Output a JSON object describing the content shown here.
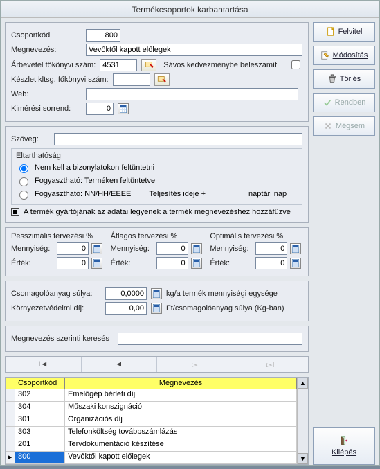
{
  "title": "Termékcsoportok karbantartása",
  "labels": {
    "csoportkod": "Csoportkód",
    "megnevezes": "Megnevezés:",
    "arbevetel": "Árbevétel főkönyvi szám:",
    "savos": "Sávos kedvezménybe beleszámít",
    "keszlet": "Készlet kltsg. főkönyvi szám:",
    "web": "Web:",
    "kimeresi": "Kimérési sorrend:",
    "szoveg": "Szöveg:",
    "eltart": "Eltarthatóság",
    "radio1": "Nem kell a bizonylatokon feltüntetni",
    "radio2": "Fogyasztható: Terméken feltüntetve",
    "radio3": "Fogyasztható: NN/HH/EEEE",
    "teljesites": "Teljesítés ideje +",
    "naptari": "naptári nap",
    "gyarto": "A termék gyártójának az adatai legyenek a termék megnevezéshez hozzáfűzve",
    "pessz": "Pesszimális tervezési %",
    "atlag": "Átlagos tervezési %",
    "opt": "Optimális tervezési %",
    "menny": "Mennyiség:",
    "ertek": "Érték:",
    "csomag": "Csomagolóanyag súlya:",
    "csomag_unit": "kg/a termék mennyiségi egysége",
    "korny": "Környezetvédelmi díj:",
    "korny_unit": "Ft/csomagolóanyag súlya (Kg-ban)",
    "kereses": "Megnevezés szerinti keresés"
  },
  "values": {
    "csoportkod": "800",
    "megnevezes": "Vevőktől kapott előlegek",
    "arbevetel": "4531",
    "keszlet": "",
    "web": "",
    "kimeresi": "0",
    "szoveg": "",
    "pessz_m": "0",
    "pessz_e": "0",
    "atlag_m": "0",
    "atlag_e": "0",
    "opt_m": "0",
    "opt_e": "0",
    "csomag": "0,0000",
    "korny": "0,00",
    "kereses": ""
  },
  "buttons": {
    "felvitel": "Felvitel",
    "modositas": "Módosítás",
    "torles": "Törlés",
    "rendben": "Rendben",
    "megsem": "Mégsem",
    "kilepes": "Kilépés"
  },
  "grid": {
    "col_code": "Csoportkód",
    "col_name": "Megnevezés",
    "rows": [
      {
        "code": "302",
        "name": "Emelőgép bérleti díj"
      },
      {
        "code": "304",
        "name": "Műszaki konszignáció"
      },
      {
        "code": "301",
        "name": "Organizációs díj"
      },
      {
        "code": "303",
        "name": "Telefonköltség továbbszámlázás"
      },
      {
        "code": "201",
        "name": "Tervdokumentáció készítése"
      },
      {
        "code": "800",
        "name": "Vevőktől kapott előlegek"
      }
    ],
    "selected": 5
  }
}
